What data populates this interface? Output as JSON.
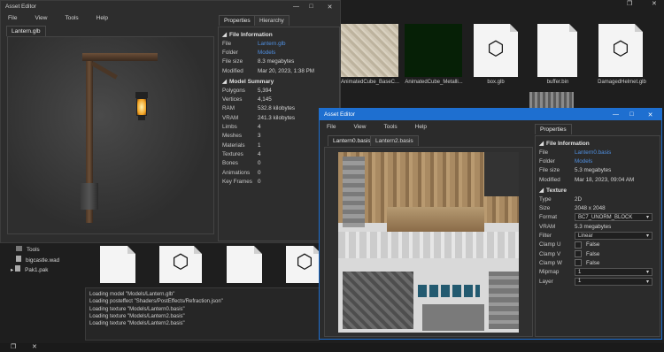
{
  "bg_window": {
    "controls": {
      "restore": "❐",
      "close": "✕"
    },
    "thumbs": [
      {
        "label": "AnimatedCube_BaseC..."
      },
      {
        "label": "AnimatedCube_Metalli..."
      },
      {
        "label": "box.glb"
      },
      {
        "label": "buffer.bin"
      },
      {
        "label": "DamagedHelmet.glb"
      }
    ],
    "tree": [
      {
        "icon": "folder-icon",
        "label": "Tools"
      },
      {
        "icon": "file-icon",
        "label": "bigcastle.wad"
      },
      {
        "icon": "file-icon",
        "label": "Pak1.pak",
        "expander": "▸"
      }
    ],
    "log": [
      "Loading model \"Models/Lantern.glb\"",
      "Loading posteffect \"Shaders/PostEffects/Refraction.json\"",
      "Loading texture \"Models/Lantern0.basis\"",
      "Loading texture \"Models/Lantern2.basis\"",
      "Loading texture \"Models/Lantern2.basis\""
    ]
  },
  "win1": {
    "title": "Asset Editor",
    "controls": {
      "minimize": "—",
      "maximize": "□",
      "close": "✕"
    },
    "menu": [
      "File",
      "View",
      "Tools",
      "Help"
    ],
    "viewport_tab": "Lantern.glb",
    "panel_tabs": [
      "Properties",
      "Hierarchy"
    ],
    "file_info": {
      "header": "File Information",
      "rows": [
        {
          "k": "File",
          "v": "Lantern.glb",
          "link": true
        },
        {
          "k": "Folder",
          "v": "Models",
          "link": true
        },
        {
          "k": "File size",
          "v": "8.3 megabytes"
        },
        {
          "k": "Modified",
          "v": "Mar 20, 2023, 1:38 PM"
        }
      ]
    },
    "model_summary": {
      "header": "Model Summary",
      "rows": [
        {
          "k": "Polygons",
          "v": "5,394"
        },
        {
          "k": "Vertices",
          "v": "4,145"
        },
        {
          "k": "RAM",
          "v": "532.8 kilobytes"
        },
        {
          "k": "VRAM",
          "v": "241.3 kilobytes"
        },
        {
          "k": "Limbs",
          "v": "4"
        },
        {
          "k": "Meshes",
          "v": "3"
        },
        {
          "k": "Materials",
          "v": "1"
        },
        {
          "k": "Textures",
          "v": "4"
        },
        {
          "k": "Bones",
          "v": "0"
        },
        {
          "k": "Animations",
          "v": "0"
        },
        {
          "k": "Key Frames",
          "v": "0"
        }
      ]
    }
  },
  "win2": {
    "title": "Asset Editor",
    "controls": {
      "minimize": "—",
      "maximize": "□",
      "close": "✕"
    },
    "menu": [
      "File",
      "View",
      "Tools",
      "Help"
    ],
    "tabs": [
      "Lantern0.basis",
      "Lantern2.basis"
    ],
    "panel_tab": "Properties",
    "file_info": {
      "header": "File Information",
      "rows": [
        {
          "k": "File",
          "v": "Lantern0.basis",
          "link": true
        },
        {
          "k": "Folder",
          "v": "Models",
          "link": true
        },
        {
          "k": "File size",
          "v": "5.3 megabytes"
        },
        {
          "k": "Modified",
          "v": "Mar 18, 2023, 09:04 AM"
        }
      ]
    },
    "texture": {
      "header": "Texture",
      "type_k": "Type",
      "type_v": "2D",
      "size_k": "Size",
      "size_v": "2048 x 2048",
      "format_k": "Format",
      "format_v": "BC7_UNORM_BLOCK",
      "vram_k": "VRAM",
      "vram_v": "5.3 megabytes",
      "filter_k": "Filter",
      "filter_v": "Linear",
      "clampu_k": "Clamp U",
      "clampu_v": "False",
      "clampv_k": "Clamp V",
      "clampv_v": "False",
      "clampw_k": "Clamp W",
      "clampw_v": "False",
      "mipmap_k": "Mipmap",
      "mipmap_v": "1",
      "layer_k": "Layer",
      "layer_v": "1"
    }
  },
  "colors": {
    "accent": "#1e6fd0",
    "link": "#4f8fe0",
    "bg": "#1e1e1e",
    "panel": "#2b2b2b"
  }
}
